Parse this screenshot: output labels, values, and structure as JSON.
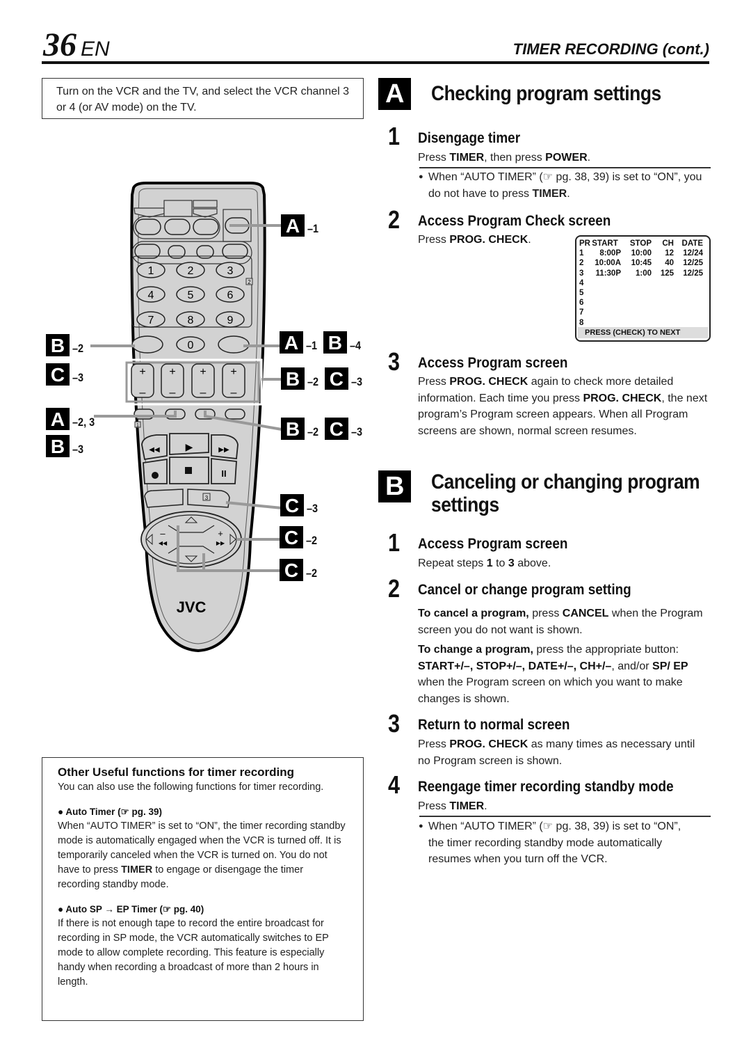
{
  "header": {
    "page_number": "36",
    "language": "EN",
    "section_title": "TIMER RECORDING (cont.)"
  },
  "note": "Turn on the VCR and the TV, and select the VCR channel 3 or 4 (or AV mode) on the TV.",
  "section_a": {
    "letter": "A",
    "title": "Checking program settings",
    "steps": [
      {
        "num": "1",
        "heading": "Disengage timer",
        "text_pre": "Press ",
        "b1": "TIMER",
        "text_mid": ", then press ",
        "b2": "POWER",
        "text_end": ".",
        "bullet_pre": "When “AUTO TIMER” (☞ pg. 38, 39) is set to “ON”, you do not have to press ",
        "bullet_bold": "TIMER",
        "bullet_end": "."
      },
      {
        "num": "2",
        "heading": "Access Program Check screen",
        "text_pre": "Press ",
        "b1": "PROG. CHECK",
        "text_end": "."
      },
      {
        "num": "3",
        "heading": "Access Program screen",
        "p1": "Press ",
        "b1": "PROG. CHECK",
        "p2": " again to check more detailed information. Each time you press ",
        "b2": "PROG. CHECK",
        "p3": ", the next program’s Program screen appears. When all Program screens are shown, normal screen resumes."
      }
    ]
  },
  "osd": {
    "headers": [
      "PR",
      "START",
      "STOP",
      "CH",
      "DATE"
    ],
    "rows": [
      [
        "1",
        "8:00P",
        "10:00",
        "12",
        "12/24"
      ],
      [
        "2",
        "10:00A",
        "10:45",
        "40",
        "12/25"
      ],
      [
        "3",
        "11:30P",
        "1:00",
        "125",
        "12/25"
      ],
      [
        "4",
        "",
        "",
        "",
        ""
      ],
      [
        "5",
        "",
        "",
        "",
        ""
      ],
      [
        "6",
        "",
        "",
        "",
        ""
      ],
      [
        "7",
        "",
        "",
        "",
        ""
      ],
      [
        "8",
        "",
        "",
        "",
        ""
      ]
    ],
    "footer": "PRESS (CHECK) TO NEXT"
  },
  "section_b": {
    "letter": "B",
    "title_line1": "Canceling or changing program",
    "title_line2": "settings",
    "steps": [
      {
        "num": "1",
        "heading": "Access Program screen",
        "p1": "Repeat steps ",
        "b1": "1",
        "p2": " to ",
        "b2": "3",
        "p3": " above."
      },
      {
        "num": "2",
        "heading": "Cancel or change program setting",
        "cancel_bold": "To cancel a program,",
        "cancel_p1": " press ",
        "cancel_b2": "CANCEL",
        "cancel_p2": " when the Program screen you do not want is shown.",
        "change_bold": "To change a program,",
        "change_p1": " press the appropriate button: ",
        "change_b1": "START+/–, STOP+/–, DATE+/–, CH+/–",
        "change_p2": ", and/or ",
        "change_b2": "SP/ EP",
        "change_p3": " when the Program screen on which you want to make changes is shown."
      },
      {
        "num": "3",
        "heading": "Return to normal screen",
        "p1": "Press ",
        "b1": "PROG. CHECK",
        "p2": " as many times as necessary until no Program screen is shown."
      },
      {
        "num": "4",
        "heading": "Reengage timer recording standby mode",
        "p1": "Press ",
        "b1": "TIMER",
        "p2": ".",
        "bullet": "When “AUTO TIMER” (☞ pg. 38, 39) is set to “ON”, the timer recording standby mode automatically resumes when you turn off the VCR."
      }
    ]
  },
  "other_box": {
    "title": "Other Useful functions for timer recording",
    "intro": "You can also use the following functions for timer recording.",
    "items": [
      {
        "title": "● Auto Timer (☞ pg. 39)",
        "p1": "When “AUTO TIMER” is set to “ON”, the timer recording standby mode is automatically engaged when the VCR is turned off. It is temporarily canceled when the VCR is turned on. You do not have to press ",
        "b1": "TIMER",
        "p2": " to engage or disengage the timer recording standby mode."
      },
      {
        "title": "● Auto SP → EP Timer (☞ pg. 40)",
        "p1": "If there is not enough tape to record the entire broadcast for recording in SP mode, the VCR automatically switches to EP mode to allow complete recording. This feature is especially handy when recording a broadcast of more than 2 hours in length."
      }
    ]
  },
  "remote": {
    "brand": "JVC",
    "keypad": [
      "1",
      "2",
      "3",
      "4",
      "5",
      "6",
      "7",
      "8",
      "9",
      "0"
    ],
    "plus": "+",
    "minus": "–",
    "markers": [
      "2",
      "1",
      "3"
    ],
    "callouts": {
      "a1_top": {
        "l1": "A",
        "s1": "–1"
      },
      "a1_b4": {
        "l1": "A",
        "s1": "–1",
        "l2": "B",
        "s2": "–4"
      },
      "b2_c3_a": {
        "l1": "B",
        "s1": "–2",
        "l2": "C",
        "s2": "–3"
      },
      "b2_c3_b": {
        "l1": "B",
        "s1": "–2",
        "l2": "C",
        "s2": "–3"
      },
      "c3": {
        "l1": "C",
        "s1": "–3"
      },
      "c2_a": {
        "l1": "C",
        "s1": "–2"
      },
      "c2_b": {
        "l1": "C",
        "s1": "–2"
      },
      "left_b2": {
        "l1": "B",
        "s1": "–2"
      },
      "left_c3": {
        "l1": "C",
        "s1": "–3"
      },
      "left_a23": {
        "l1": "A",
        "s1": "–2, 3"
      },
      "left_b3": {
        "l1": "B",
        "s1": "–3"
      }
    }
  }
}
